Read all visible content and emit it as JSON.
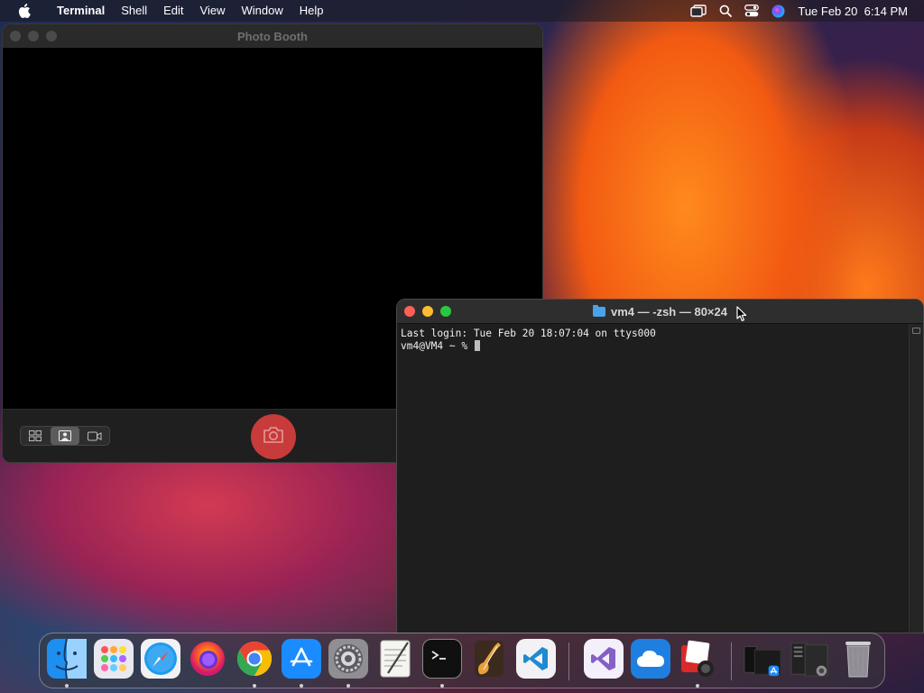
{
  "menubar": {
    "app_name": "Terminal",
    "menus": [
      "Shell",
      "Edit",
      "View",
      "Window",
      "Help"
    ],
    "clock": "Tue Feb 20  6:14 PM",
    "status_icons": [
      "screen-mirroring-icon",
      "spotlight-search-icon",
      "control-center-icon",
      "siri-icon"
    ]
  },
  "photo_booth": {
    "title": "Photo Booth",
    "modes": [
      "grid-view-icon",
      "single-photo-icon",
      "video-icon"
    ],
    "active_mode": "single-photo-icon",
    "accent": "#c73b3b"
  },
  "terminal": {
    "title": "vm4 — -zsh — 80×24",
    "lines": [
      "Last login: Tue Feb 20 18:07:04 on ttys000",
      "vm4@VM4 ~ % "
    ],
    "accent": "#1e1e1e"
  },
  "dock": {
    "apps": [
      {
        "name": "Finder",
        "icon": "finder-icon",
        "running": true
      },
      {
        "name": "Launchpad",
        "icon": "launchpad-icon",
        "running": false
      },
      {
        "name": "Safari",
        "icon": "safari-icon",
        "running": false
      },
      {
        "name": "Firefox",
        "icon": "firefox-icon",
        "running": false
      },
      {
        "name": "Google Chrome",
        "icon": "chrome-icon",
        "running": true
      },
      {
        "name": "App Store",
        "icon": "app-store-icon",
        "running": true
      },
      {
        "name": "System Settings",
        "icon": "system-settings-icon",
        "running": true
      },
      {
        "name": "TextEdit",
        "icon": "textedit-icon",
        "running": false
      },
      {
        "name": "Terminal",
        "icon": "terminal-icon",
        "running": true
      },
      {
        "name": "GarageBand",
        "icon": "garageband-icon",
        "running": false
      },
      {
        "name": "Visual Studio Code",
        "icon": "vscode-icon",
        "running": false
      },
      {
        "name": "Visual Studio",
        "icon": "visual-studio-icon",
        "running": false
      },
      {
        "name": "iCloud",
        "icon": "icloud-icon",
        "running": false
      },
      {
        "name": "Photo Booth",
        "icon": "photo-booth-icon",
        "running": true
      },
      {
        "name": "Recent: App Store",
        "icon": "recent-app-store-icon",
        "running": false
      },
      {
        "name": "Recent: System Settings",
        "icon": "recent-settings-icon",
        "running": false
      },
      {
        "name": "Trash",
        "icon": "trash-icon",
        "running": false
      }
    ]
  }
}
